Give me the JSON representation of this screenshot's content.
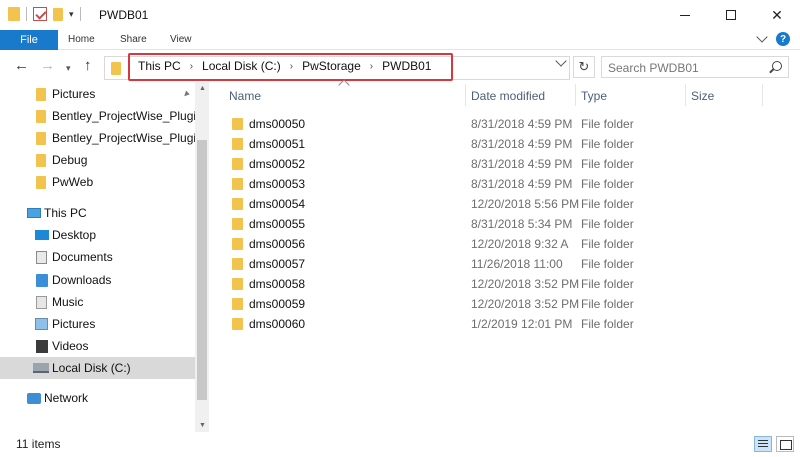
{
  "window": {
    "title": "PWDB01",
    "minimize_icon": "minimize-icon",
    "maximize_icon": "maximize-icon",
    "close_label": "✕"
  },
  "ribbon": {
    "tabs": [
      {
        "label": "File"
      },
      {
        "label": "Home"
      },
      {
        "label": "Share"
      },
      {
        "label": "View"
      }
    ],
    "help_label": "?"
  },
  "address": {
    "breadcrumbs": [
      {
        "label": "This PC"
      },
      {
        "label": "Local Disk (C:)"
      },
      {
        "label": "PwStorage"
      },
      {
        "label": "PWDB01"
      }
    ],
    "separator": "›",
    "highlight_color": "#d9363e"
  },
  "search": {
    "placeholder": "Search PWDB01"
  },
  "nav_pane": {
    "items": [
      {
        "label": "Pictures",
        "icon": "folder-icon",
        "pinned": true
      },
      {
        "label": "Bentley_ProjectWise_Plugin",
        "icon": "folder-icon"
      },
      {
        "label": "Bentley_ProjectWise_Plugin_C",
        "icon": "folder-icon"
      },
      {
        "label": "Debug",
        "icon": "folder-icon"
      },
      {
        "label": "PwWeb",
        "icon": "folder-icon"
      },
      {
        "label": "This PC",
        "icon": "computer-icon"
      },
      {
        "label": "Desktop",
        "icon": "desktop-icon"
      },
      {
        "label": "Documents",
        "icon": "documents-icon"
      },
      {
        "label": "Downloads",
        "icon": "downloads-icon"
      },
      {
        "label": "Music",
        "icon": "music-icon"
      },
      {
        "label": "Pictures",
        "icon": "pictures-icon"
      },
      {
        "label": "Videos",
        "icon": "videos-icon"
      },
      {
        "label": "Local Disk (C:)",
        "icon": "disk-icon",
        "selected": true
      },
      {
        "label": "Network",
        "icon": "network-icon"
      }
    ]
  },
  "columns": {
    "name": "Name",
    "date_modified": "Date modified",
    "type": "Type",
    "size": "Size"
  },
  "files": [
    {
      "name": "dms00050",
      "date": "8/31/2018 4:59 PM",
      "type": "File folder"
    },
    {
      "name": "dms00051",
      "date": "8/31/2018 4:59 PM",
      "type": "File folder"
    },
    {
      "name": "dms00052",
      "date": "8/31/2018 4:59 PM",
      "type": "File folder"
    },
    {
      "name": "dms00053",
      "date": "8/31/2018 4:59 PM",
      "type": "File folder"
    },
    {
      "name": "dms00054",
      "date": "12/20/2018 5:56 PM",
      "type": "File folder"
    },
    {
      "name": "dms00055",
      "date": "8/31/2018 5:34 PM",
      "type": "File folder"
    },
    {
      "name": "dms00056",
      "date": "12/20/2018 9:32 A",
      "type": "File folder"
    },
    {
      "name": "dms00057",
      "date": "11/26/2018 11:00",
      "type": "File folder"
    },
    {
      "name": "dms00058",
      "date": "12/20/2018 3:52 PM",
      "type": "File folder"
    },
    {
      "name": "dms00059",
      "date": "12/20/2018 3:52 PM",
      "type": "File folder"
    },
    {
      "name": "dms00060",
      "date": "1/2/2019 12:01 PM",
      "type": "File folder"
    }
  ],
  "status": {
    "item_count": "11 items"
  },
  "colors": {
    "accent": "#1979ca",
    "folder": "#f2c44e",
    "selected_bg": "#d9d9d9"
  }
}
